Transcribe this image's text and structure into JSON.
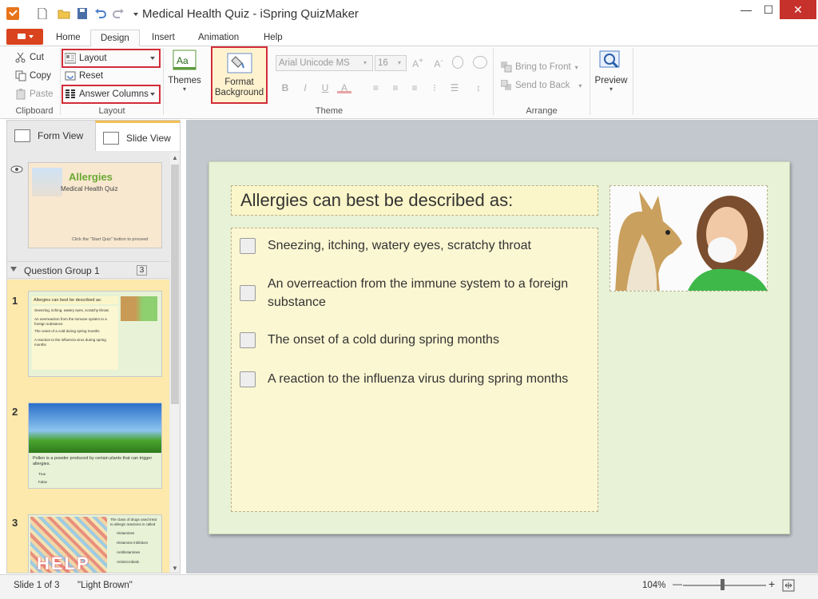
{
  "window": {
    "title": "Medical Health Quiz - iSpring QuizMaker",
    "minimize": "—",
    "maximize": "☐",
    "close": "✕"
  },
  "tabs": [
    {
      "label": "Home"
    },
    {
      "label": "Design"
    },
    {
      "label": "Insert"
    },
    {
      "label": "Animation"
    },
    {
      "label": "Help"
    }
  ],
  "ribbon": {
    "clipboard": {
      "label": "Clipboard",
      "cut": "Cut",
      "copy": "Copy",
      "paste": "Paste"
    },
    "layout": {
      "label": "Layout",
      "layout": "Layout",
      "reset": "Reset",
      "answer_columns": "Answer Columns"
    },
    "themes": {
      "label": "Themes"
    },
    "format_background": {
      "line1": "Format",
      "line2": "Background"
    },
    "theme": {
      "label": "Theme",
      "font": "Arial Unicode MS",
      "size": "16"
    },
    "arrange": {
      "label": "Arrange",
      "bring_to_front": "Bring to Front",
      "send_to_back": "Send to Back"
    },
    "preview": {
      "label": "Preview"
    }
  },
  "left": {
    "form_view": "Form View",
    "slide_view": "Slide View",
    "intro": {
      "title": "Allergies",
      "subtitle": "Medical Health Quiz",
      "hint": "Click the \"Start Quiz\" button to proceed"
    },
    "group": {
      "name": "Question Group 1",
      "count": "3"
    },
    "slides": [
      {
        "num": "1",
        "q": "Allergies can best be described as:",
        "a": [
          "Sneezing, itching, watery eyes, scratchy throat",
          "An overreaction from the immune system to a foreign substance",
          "The onset of a cold during spring months",
          "A reaction to the influenza virus during spring months"
        ]
      },
      {
        "num": "2",
        "q": "Pollen is a powder produced by certain plants that can trigger allergies.",
        "a": [
          "True",
          "False"
        ]
      },
      {
        "num": "3",
        "q": "The class of drugs used treat to allergic reactions is called",
        "a": [
          "Histamines",
          "Histamine inhibitors",
          "Antihistamines",
          "Antimicrobials"
        ],
        "word": "HELP"
      }
    ]
  },
  "slide": {
    "question": "Allergies can best be described as:",
    "answers": [
      "Sneezing, itching, watery eyes, scratchy throat",
      "An overreaction from the immune system to a foreign substance",
      "The onset of a cold during spring months",
      "A reaction to the influenza virus during spring months"
    ]
  },
  "status": {
    "slide": "Slide 1 of 3",
    "theme": "\"Light Brown\"",
    "zoom": "104%",
    "minus": "—",
    "plus": "+"
  },
  "colors": {
    "accent": "#d22c38",
    "file_tab": "#d9431e",
    "slide_bg": "#e7f2d6",
    "answer_bg": "#fbf7d2"
  }
}
